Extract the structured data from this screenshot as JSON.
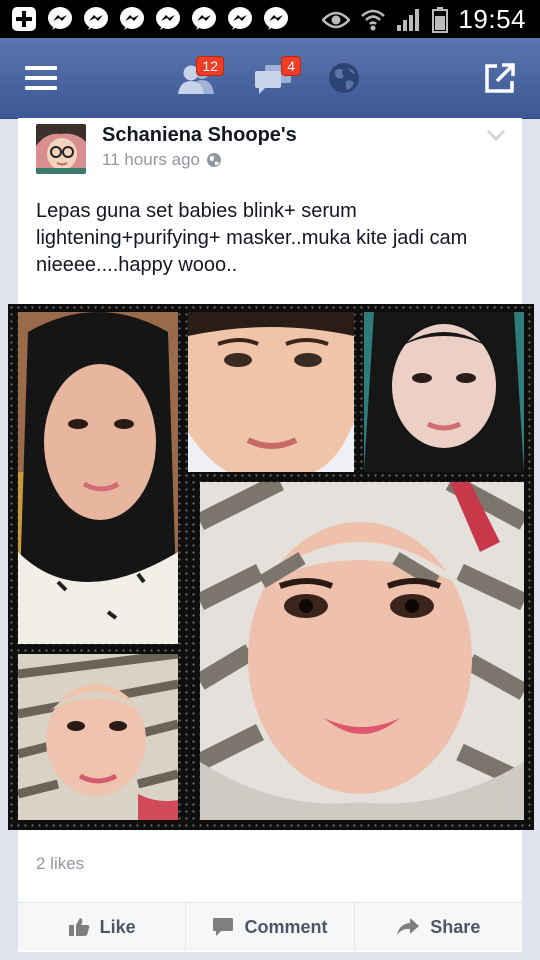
{
  "status_bar": {
    "time": "19:54",
    "notification_icons": [
      "plus-icon",
      "messenger-icon",
      "messenger-icon",
      "messenger-icon",
      "messenger-icon",
      "messenger-icon",
      "messenger-icon",
      "messenger-icon"
    ]
  },
  "nav": {
    "friend_requests_count": "12",
    "messages_count": "4"
  },
  "post": {
    "author": "Schaniena Shoope's",
    "time": "11 hours ago",
    "text": "Lepas guna set babies blink+ serum lightening+purifying+ masker..muka kite jadi cam nieeee....happy wooo..",
    "likes": "2 likes"
  },
  "actions": {
    "like": "Like",
    "comment": "Comment",
    "share": "Share"
  },
  "colors": {
    "facebook_blue": "#3b5998",
    "badge_red": "#f03d25",
    "muted_text": "#9197a3"
  }
}
